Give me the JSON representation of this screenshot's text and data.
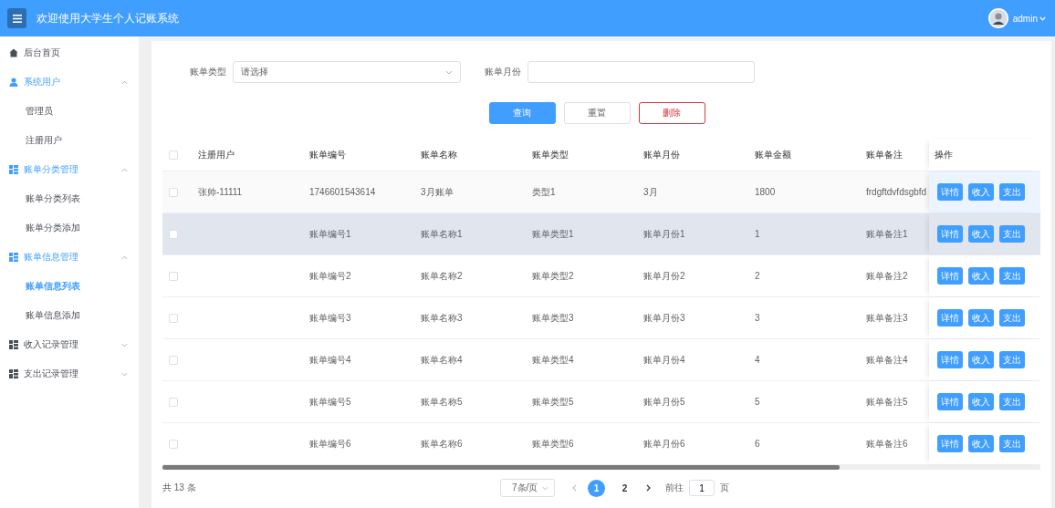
{
  "header": {
    "title": "欢迎使用大学生个人记账系统",
    "user": "admin"
  },
  "sidebar": {
    "items": [
      {
        "label": "后台首页",
        "kind": "page"
      },
      {
        "label": "系统用户",
        "kind": "group",
        "expanded": true,
        "children": [
          {
            "label": "管理员",
            "selected": false
          },
          {
            "label": "注册用户",
            "selected": false
          }
        ]
      },
      {
        "label": "账单分类管理",
        "kind": "group",
        "expanded": true,
        "children": [
          {
            "label": "账单分类列表",
            "selected": false
          },
          {
            "label": "账单分类添加",
            "selected": false
          }
        ]
      },
      {
        "label": "账单信息管理",
        "kind": "group",
        "expanded": true,
        "children": [
          {
            "label": "账单信息列表",
            "selected": true
          },
          {
            "label": "账单信息添加",
            "selected": false
          }
        ]
      },
      {
        "label": "收入记录管理",
        "kind": "group",
        "expanded": false
      },
      {
        "label": "支出记录管理",
        "kind": "group",
        "expanded": false
      }
    ]
  },
  "filters": [
    {
      "label": "账单类型",
      "kind": "select",
      "placeholder": "请选择"
    },
    {
      "label": "账单月份",
      "kind": "input"
    }
  ],
  "buttons": [
    {
      "label": "查询",
      "kind": "primary"
    },
    {
      "label": "重置",
      "kind": "default"
    },
    {
      "label": "删除",
      "kind": "danger"
    }
  ],
  "table": {
    "all_checked": false,
    "columns": [
      "注册用户",
      "账单编号",
      "账单名称",
      "账单类型",
      "账单月份",
      "账单金额",
      "账单备注"
    ],
    "action_column": "操作",
    "rows": [
      {
        "checked": false,
        "hovered": true,
        "selected": false,
        "cells": [
          "张帅-11111",
          "1746601543614",
          "3月账单",
          "类型1",
          "3月",
          "1800",
          "frdgftdvfdsgbfd"
        ],
        "actions": [
          "详情",
          "收入",
          "支出"
        ]
      },
      {
        "checked": false,
        "hovered": false,
        "selected": true,
        "cells": [
          "",
          "账单编号1",
          "账单名称1",
          "账单类型1",
          "账单月份1",
          "1",
          "账单备注1"
        ],
        "actions": [
          "详情",
          "收入",
          "支出"
        ]
      },
      {
        "checked": false,
        "hovered": false,
        "selected": false,
        "cells": [
          "",
          "账单编号2",
          "账单名称2",
          "账单类型2",
          "账单月份2",
          "2",
          "账单备注2"
        ],
        "actions": [
          "详情",
          "收入",
          "支出"
        ]
      },
      {
        "checked": false,
        "hovered": false,
        "selected": false,
        "cells": [
          "",
          "账单编号3",
          "账单名称3",
          "账单类型3",
          "账单月份3",
          "3",
          "账单备注3"
        ],
        "actions": [
          "详情",
          "收入",
          "支出"
        ]
      },
      {
        "checked": false,
        "hovered": false,
        "selected": false,
        "cells": [
          "",
          "账单编号4",
          "账单名称4",
          "账单类型4",
          "账单月份4",
          "4",
          "账单备注4"
        ],
        "actions": [
          "详情",
          "收入",
          "支出"
        ]
      },
      {
        "checked": false,
        "hovered": false,
        "selected": false,
        "cells": [
          "",
          "账单编号5",
          "账单名称5",
          "账单类型5",
          "账单月份5",
          "5",
          "账单备注5"
        ],
        "actions": [
          "详情",
          "收入",
          "支出"
        ]
      },
      {
        "checked": false,
        "hovered": false,
        "selected": false,
        "cells": [
          "",
          "账单编号6",
          "账单名称6",
          "账单类型6",
          "账单月份6",
          "6",
          "账单备注6"
        ],
        "actions": [
          "详情",
          "收入",
          "支出"
        ]
      }
    ]
  },
  "pagination": {
    "total": "共 13 条",
    "page_size": "7条/页",
    "pages": [
      {
        "label": "1",
        "selected": true
      },
      {
        "label": "2",
        "selected": false
      }
    ],
    "goto_label": "前往",
    "goto_value": "1",
    "goto_suffix": "页"
  }
}
